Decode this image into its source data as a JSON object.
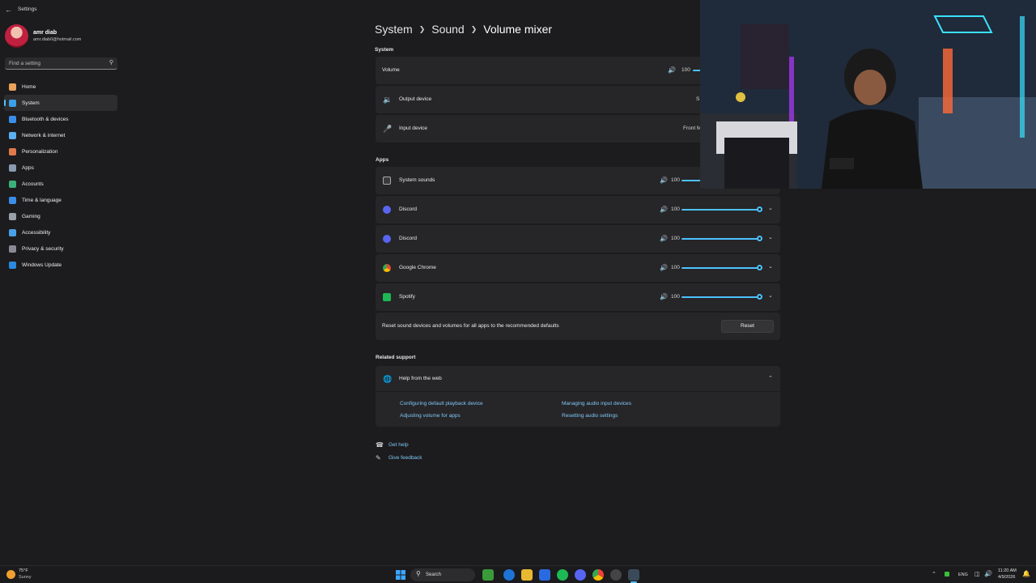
{
  "window": {
    "title": "Settings"
  },
  "profile": {
    "name": "amr diab",
    "email": "amr.diab0@hotmail.com"
  },
  "search": {
    "placeholder": "Find a setting"
  },
  "nav": [
    {
      "label": "Home",
      "icon": "home-icon",
      "color": "#e8a25a"
    },
    {
      "label": "System",
      "icon": "system-icon",
      "color": "#3aa0e8"
    },
    {
      "label": "Bluetooth & devices",
      "icon": "bluetooth-icon",
      "color": "#3a8ee8"
    },
    {
      "label": "Network & internet",
      "icon": "network-icon",
      "color": "#5ab0f0"
    },
    {
      "label": "Personalization",
      "icon": "brush-icon",
      "color": "#e07a4a"
    },
    {
      "label": "Apps",
      "icon": "apps-icon",
      "color": "#8a9ab0"
    },
    {
      "label": "Accounts",
      "icon": "accounts-icon",
      "color": "#3ab07a"
    },
    {
      "label": "Time & language",
      "icon": "globe-clock-icon",
      "color": "#3a8ee8"
    },
    {
      "label": "Gaming",
      "icon": "gaming-icon",
      "color": "#9aa0a8"
    },
    {
      "label": "Accessibility",
      "icon": "accessibility-icon",
      "color": "#4aa0e8"
    },
    {
      "label": "Privacy & security",
      "icon": "shield-icon",
      "color": "#8a8a95"
    },
    {
      "label": "Windows Update",
      "icon": "update-icon",
      "color": "#2a8ae0"
    }
  ],
  "breadcrumb": {
    "system": "System",
    "sound": "Sound",
    "current": "Volume mixer"
  },
  "system_section": {
    "label": "System",
    "volume": {
      "label": "Volume",
      "value": "100"
    },
    "output": {
      "label": "Output device",
      "value": "S"
    },
    "input": {
      "label": "Input device",
      "value": "Front M"
    }
  },
  "apps_section": {
    "label": "Apps",
    "items": [
      {
        "label": "System sounds",
        "value": "100",
        "level": 1.0,
        "icon": "system-sounds-icon"
      },
      {
        "label": "Discord",
        "value": "100",
        "level": 1.0,
        "icon": "discord-icon"
      },
      {
        "label": "Discord",
        "value": "100",
        "level": 1.0,
        "icon": "discord-icon"
      },
      {
        "label": "Google Chrome",
        "value": "100",
        "level": 1.0,
        "icon": "chrome-icon"
      },
      {
        "label": "Spotify",
        "value": "100",
        "level": 1.0,
        "icon": "spotify-icon"
      }
    ]
  },
  "reset": {
    "text": "Reset sound devices and volumes for all apps to the recommended defaults",
    "button": "Reset"
  },
  "related": {
    "label": "Related support",
    "help_title": "Help from the web",
    "links": [
      "Configuring default playback device",
      "Managing audio input devices",
      "Adjusting volume for apps",
      "Resetting audio settings"
    ]
  },
  "footer": {
    "get_help": "Get help",
    "give_feedback": "Give feedback"
  },
  "taskbar": {
    "weather_temp": "75°F",
    "weather_cond": "Sunny",
    "search": "Search",
    "lang": "ENG",
    "time": "11:20 AM",
    "date": "4/9/2026"
  },
  "colors": {
    "accent": "#4cc2ff",
    "background": "#1c1b1d",
    "card": "#262527"
  }
}
